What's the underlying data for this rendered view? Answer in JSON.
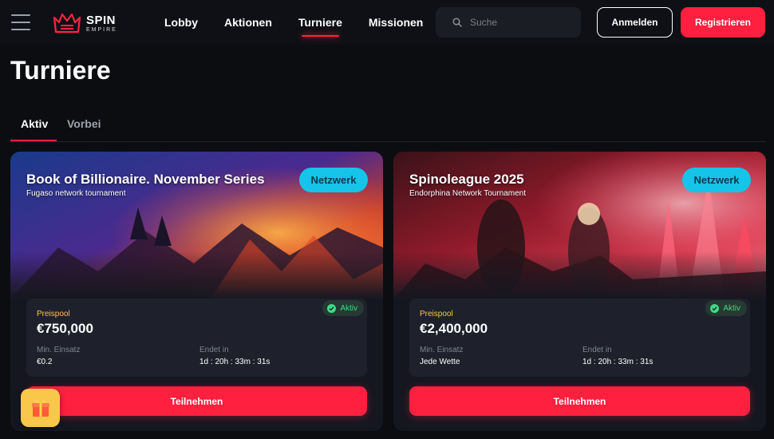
{
  "header": {
    "logo": {
      "line1": "SPIN",
      "line2": "EMPIRE"
    },
    "nav": [
      "Lobby",
      "Aktionen",
      "Turniere",
      "Missionen"
    ],
    "active_nav": "Turniere",
    "search_placeholder": "Suche",
    "login_label": "Anmelden",
    "register_label": "Registrieren"
  },
  "page": {
    "title": "Turniere",
    "tabs": [
      "Aktiv",
      "Vorbei"
    ],
    "active_tab": "Aktiv"
  },
  "tournaments": [
    {
      "title": "Book of Billionaire. November Series",
      "subtitle": "Fugaso network tournament",
      "badge": "Netzwerk",
      "status": "Aktiv",
      "prize_label": "Preispool",
      "prize_value": "€750,000",
      "min_bet_label": "Min. Einsatz",
      "min_bet_value": "€0.2",
      "ends_label": "Endet in",
      "ends_value": "1d : 20h : 33m : 31s",
      "join_label": "Teilnehmen"
    },
    {
      "title": "Spinoleague 2025",
      "subtitle": "Endorphina Network Tournament",
      "badge": "Netzwerk",
      "status": "Aktiv",
      "prize_label": "Preispool",
      "prize_value": "€2,400,000",
      "min_bet_label": "Min. Einsatz",
      "min_bet_value": "Jede Wette",
      "ends_label": "Endet in",
      "ends_value": "1d : 20h : 33m : 31s",
      "join_label": "Teilnehmen"
    }
  ],
  "colors": {
    "accent": "#ff1f3f",
    "badge": "#15c4e8",
    "status_green": "#3ddc84",
    "prize_label": "#ffc64a",
    "gift": "#f9c74a"
  },
  "icons": {
    "menu": "hamburger-icon",
    "logo": "crown-logo-icon",
    "search": "search-icon",
    "status": "check-circle-icon",
    "gift": "gift-icon"
  }
}
